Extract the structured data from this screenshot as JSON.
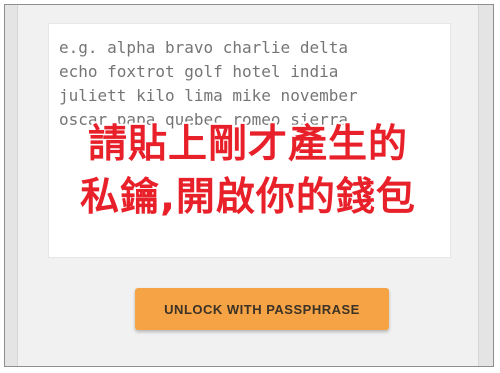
{
  "passphrase_field": {
    "placeholder_lines": [
      "e.g. alpha bravo charlie delta",
      "echo foxtrot golf hotel india",
      "juliett kilo lima mike november",
      "oscar papa quebec romeo sierra"
    ]
  },
  "overlay_annotation": {
    "line1": "請貼上剛才產生的",
    "line2": "私鑰,開啟你的錢包",
    "color": "#e8202a"
  },
  "unlock_button": {
    "label": "UNLOCK WITH PASSPHRASE",
    "color": "#f5a345"
  }
}
